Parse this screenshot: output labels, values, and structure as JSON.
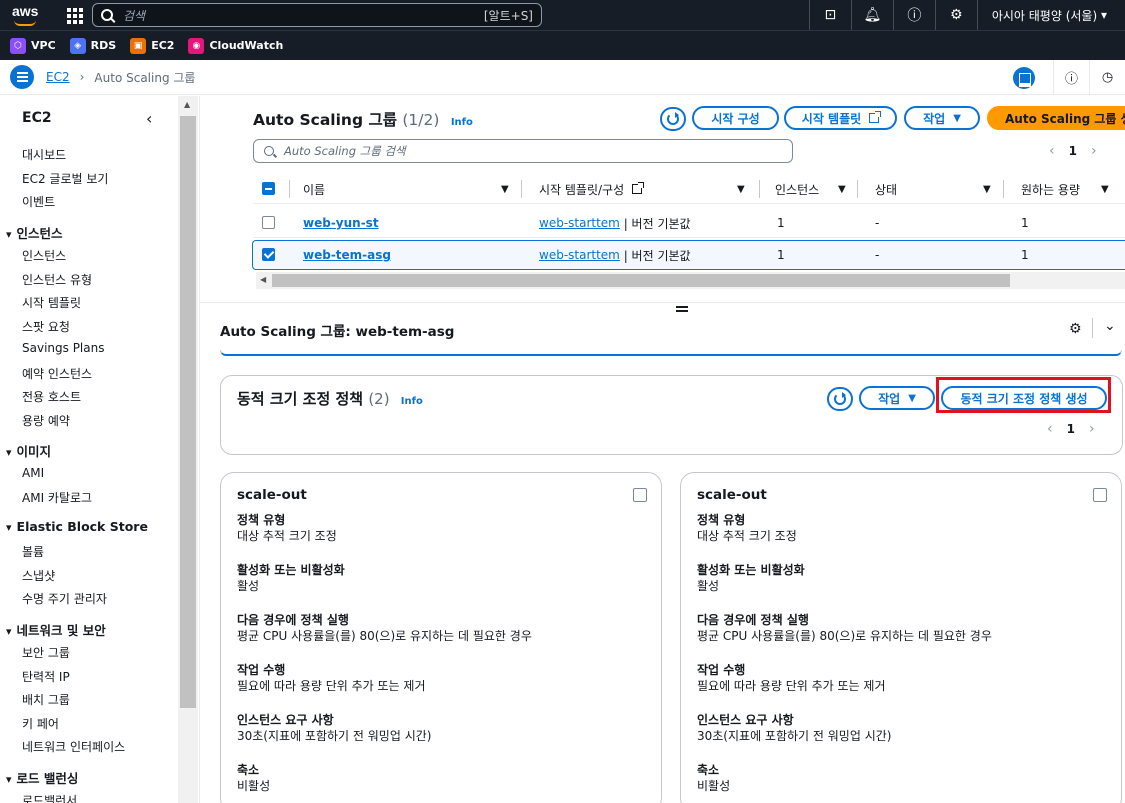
{
  "topnav": {
    "logo": "aws",
    "search_placeholder": "검색",
    "search_shortcut": "[알트+S]",
    "icons": [
      "cloudshell-icon",
      "bell-icon",
      "help-icon",
      "gear-icon"
    ],
    "region": "아시아 태평양 (서울)"
  },
  "favorites": [
    {
      "label": "VPC",
      "color": "#8c4fff"
    },
    {
      "label": "RDS",
      "color": "#4d72f3"
    },
    {
      "label": "EC2",
      "color": "#ed7100"
    },
    {
      "label": "CloudWatch",
      "color": "#e7157b"
    }
  ],
  "breadcrumb": {
    "root": "EC2",
    "current": "Auto Scaling 그룹"
  },
  "sidebar": {
    "title": "EC2",
    "items_top": [
      "대시보드",
      "EC2 글로벌 보기",
      "이벤트"
    ],
    "sections": [
      {
        "title": "인스턴스",
        "items": [
          "인스턴스",
          "인스턴스 유형",
          "시작 템플릿",
          "스팟 요청",
          "Savings Plans",
          "예약 인스턴스",
          "전용 호스트",
          "용량 예약"
        ]
      },
      {
        "title": "이미지",
        "items": [
          "AMI",
          "AMI 카탈로그"
        ]
      },
      {
        "title": "Elastic Block Store",
        "items": [
          "볼륨",
          "스냅샷",
          "수명 주기 관리자"
        ]
      },
      {
        "title": "네트워크 및 보안",
        "items": [
          "보안 그룹",
          "탄력적 IP",
          "배치 그룹",
          "키 페어",
          "네트워크 인터페이스"
        ]
      },
      {
        "title": "로드 밸런싱",
        "items": [
          "로드밸런서"
        ]
      }
    ]
  },
  "asg": {
    "title": "Auto Scaling 그룹",
    "count": "(1/2)",
    "info": "Info",
    "buttons": {
      "launch_config": "시작 구성",
      "launch_template": "시작 템플릿",
      "actions": "작업",
      "create": "Auto Scaling 그룹 생성"
    },
    "filter_placeholder": "Auto Scaling 그룹 검색",
    "page": "1",
    "columns": [
      "이름",
      "시작 템플릿/구성",
      "인스턴스",
      "상태",
      "원하는 용량"
    ],
    "rows": [
      {
        "name": "web-yun-st",
        "template": "web-starttem",
        "version": "| 버전 기본값",
        "instances": "1",
        "status": "-",
        "desired": "1",
        "selected": false
      },
      {
        "name": "web-tem-asg",
        "template": "web-starttem",
        "version": "| 버전 기본값",
        "instances": "1",
        "status": "-",
        "desired": "1",
        "selected": true
      }
    ]
  },
  "detail": {
    "title": "Auto Scaling 그룹: web-tem-asg",
    "policies": {
      "title": "동적 크기 조정 정책",
      "count": "(2)",
      "info": "Info",
      "actions": "작업",
      "create": "동적 크기 조정 정책 생성",
      "page": "1"
    },
    "cards": [
      {
        "title": "scale-out",
        "fields": [
          {
            "k": "정책 유형",
            "v": "대상 추적 크기 조정"
          },
          {
            "k": "활성화 또는 비활성화",
            "v": "활성"
          },
          {
            "k": "다음 경우에 정책 실행",
            "v": "평균 CPU 사용률을(를) 80(으)로 유지하는 데 필요한 경우"
          },
          {
            "k": "작업 수행",
            "v": "필요에 따라 용량 단위 추가 또는 제거"
          },
          {
            "k": "인스턴스 요구 사항",
            "v": "30초(지표에 포함하기 전 워밍업 시간)"
          },
          {
            "k": "축소",
            "v": "비활성"
          }
        ]
      },
      {
        "title": "scale-out",
        "fields": [
          {
            "k": "정책 유형",
            "v": "대상 추적 크기 조정"
          },
          {
            "k": "활성화 또는 비활성화",
            "v": "활성"
          },
          {
            "k": "다음 경우에 정책 실행",
            "v": "평균 CPU 사용률을(를) 80(으)로 유지하는 데 필요한 경우"
          },
          {
            "k": "작업 수행",
            "v": "필요에 따라 용량 단위 추가 또는 제거"
          },
          {
            "k": "인스턴스 요구 사항",
            "v": "30초(지표에 포함하기 전 워밍업 시간)"
          },
          {
            "k": "축소",
            "v": "비활성"
          }
        ]
      }
    ]
  },
  "colors": {
    "link": "#0972d3",
    "primary": "#ff9900",
    "nav": "#161d26",
    "highlight": "#e1111f"
  }
}
